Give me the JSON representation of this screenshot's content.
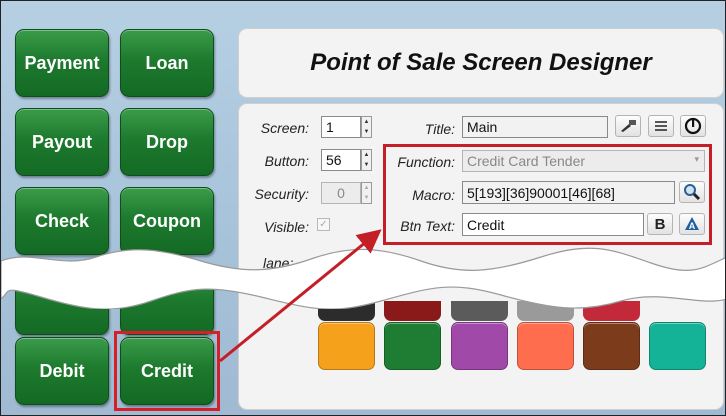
{
  "left_buttons": [
    "Payment",
    "Loan",
    "Payout",
    "Drop",
    "Check",
    "Coupon",
    "Debit",
    "Credit"
  ],
  "title": "Point of Sale Screen Designer",
  "form": {
    "screen_label": "Screen:",
    "screen_value": "1",
    "button_label": "Button:",
    "button_value": "56",
    "security_label": "Security:",
    "security_value": "0",
    "visible_label": "Visible:",
    "partial_label": "lane:",
    "title_label": "Title:",
    "title_value": "Main",
    "function_label": "Function:",
    "function_value": "Credit Card Tender",
    "macro_label": "Macro:",
    "macro_value": "5[193][36]90001[46][68]",
    "btntext_label": "Btn Text:",
    "btntext_value": "Credit",
    "bold_label": "B"
  },
  "icons": [
    "wrench-icon",
    "list-icon",
    "power-icon",
    "magnifier-icon",
    "font-color-icon"
  ],
  "swatches": [
    "#f5a11c",
    "#1f7c33",
    "#a049a8",
    "#ff6d4f",
    "#7c3b1b",
    "#14b296"
  ],
  "colors": {
    "accent_red": "#c41e26",
    "button_green": "#1d7a2e"
  }
}
